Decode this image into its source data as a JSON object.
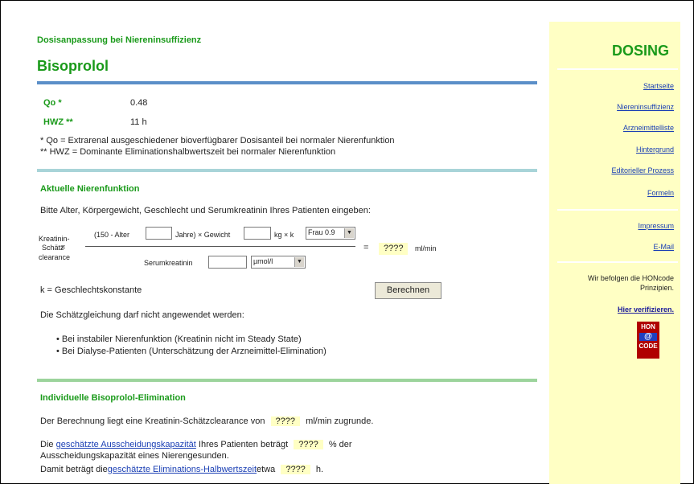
{
  "page": {
    "subtitle": "Dosisanpassung bei Niereninsuffizienz",
    "drug": "Bisoprolol",
    "qo_label": "Qo *",
    "qo_value": "0.48",
    "hwz_label": "HWZ **",
    "hwz_value": "11 h",
    "note1": "* Qo = Extrarenal ausgeschiedener bioverfügbarer Dosisanteil bei normaler Nierenfunktion",
    "note2": "** HWZ = Dominante Eliminationshalbwertszeit bei normaler Nierenfunktion"
  },
  "aktuell": {
    "heading": "Aktuelle Nierenfunktion",
    "intro": "Bitte Alter, Körpergewicht, Geschlecht und Serumkreatinin Ihres Patienten eingeben:",
    "kreat_label_1": "Kreatinin-",
    "kreat_label_2": "Schätz",
    "kreat_label_3": "clearance",
    "eq1": "=",
    "alter_prefix": "(150 - Alter",
    "jahre_text": "Jahre) × Gewicht",
    "kg_text": "kg × k",
    "sex_selected": "Frau 0.9",
    "eq2": "=",
    "result": "????",
    "unit": "ml/min",
    "serum_label": "Serumkreatinin",
    "serum_unit": "µmol/l",
    "k_text": "k = Geschlechtskonstante",
    "calc_button": "Berechnen",
    "warn": "Die Schätzgleichung darf nicht angewendet werden:",
    "bullets": [
      "Bei instabiler Nierenfunktion (Kreatinin nicht im Steady State)",
      "Bei Dialyse-Patienten (Unterschätzung der Arzneimittel-Elimination)"
    ]
  },
  "indiv": {
    "heading": "Individuelle Bisoprolol-Elimination",
    "l1_pre": "Der Berechnung liegt eine Kreatinin-Schätzclearance von",
    "l1_val": "????",
    "l1_post": "ml/min zugrunde.",
    "l2_pre": "Die",
    "l2_link": "geschätzte Ausscheidungskapazität",
    "l2_mid": "Ihres Patienten beträgt",
    "l2_val": "????",
    "l2_post": "% der",
    "l3": "Ausscheidungskapazität eines Nierengesunden.",
    "l4_pre": "Damit beträgt die",
    "l4_link": "geschätzte Eliminations-Halbwertszeit",
    "l4_mid": "etwa",
    "l4_val": "????",
    "l4_post": "h."
  },
  "sidebar": {
    "title": "DOSING",
    "nav": [
      "Startseite",
      "Niereninsuffizienz",
      "Arzneimittelliste",
      "Hintergrund",
      "Editorieller Prozess",
      "Formeln"
    ],
    "nav2": [
      "Impressum",
      "E-Mail"
    ],
    "hon_text_1": "Wir befolgen die HONcode",
    "hon_text_2": "Prinzipien.",
    "verify": "Hier verifizieren.",
    "hon_logo_1": "HON",
    "hon_logo_2": "CODE"
  }
}
